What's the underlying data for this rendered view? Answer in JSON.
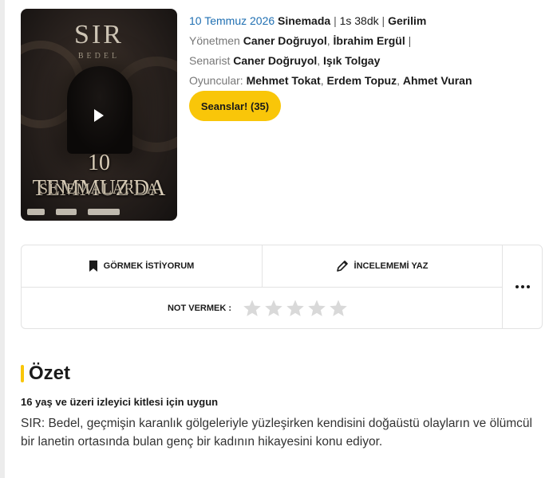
{
  "poster": {
    "title": "SIR",
    "subtitle": "BEDEL",
    "release_line": "10 TEMMUZ'DA",
    "cinema_line": "SİNEMALARDA",
    "play_icon": "play-icon"
  },
  "info": {
    "date": "10 Temmuz 2026",
    "status": "Sinemada",
    "duration": "1s 38dk",
    "genre": "Gerilim",
    "director_label": "Yönetmen",
    "directors": [
      "Caner Doğruyol",
      "İbrahim Ergül"
    ],
    "writer_label": "Senarist",
    "writers": [
      "Caner Doğruyol",
      "Işık Tolgay"
    ],
    "cast_label": "Oyuncular:",
    "cast": [
      "Mehmet Tokat",
      "Erdem Topuz",
      "Ahmet Vuran"
    ],
    "sessions_button": "Seanslar! (35)"
  },
  "actions": {
    "watchlist_label": "GÖRMEK İSTİYORUM",
    "watchlist_icon": "bookmark-icon",
    "review_label": "İNCELEMEMİ YAZ",
    "review_icon": "pencil-icon",
    "rating_label": "NOT VERMEK :",
    "rating_value": 0,
    "rating_max": 5,
    "more_icon": "more-dots-icon",
    "star_color": "#d9d9d9"
  },
  "summary": {
    "title": "Özet",
    "accent_color": "#f9c609",
    "age_note": "16 yaş ve üzeri izleyici kitlesi için uygun",
    "text": "SIR: Bedel, geçmişin karanlık gölgeleriyle yüzleşirken kendisini doğaüstü olayların ve ölümcül bir lanetin ortasında bulan genç bir kadının hikayesini konu ediyor."
  }
}
